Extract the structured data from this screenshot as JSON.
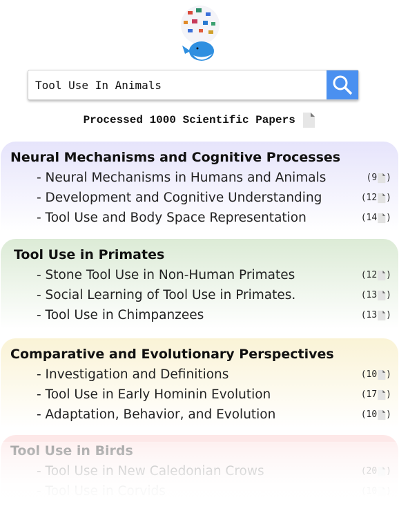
{
  "search": {
    "value": "Tool Use In Animals"
  },
  "processed_label": "Processed 1000 Scientific Papers",
  "sections": [
    {
      "title": "Neural Mechanisms and Cognitive Processes",
      "color": "#e6e4fb",
      "items": [
        {
          "label": "- Neural Mechanisms in Humans and Animals",
          "count": "9"
        },
        {
          "label": "- Development and Cognitive Understanding",
          "count": "12"
        },
        {
          "label": "- Tool Use and Body Space Representation",
          "count": "14"
        }
      ]
    },
    {
      "title": "Tool Use in Primates",
      "color": "#dcebd6",
      "items": [
        {
          "label": "- Stone Tool Use in Non-Human Primates",
          "count": "12"
        },
        {
          "label": "- Social Learning of Tool Use in Primates.",
          "count": "13"
        },
        {
          "label": "- Tool Use in Chimpanzees",
          "count": "13"
        }
      ]
    },
    {
      "title": "Comparative and Evolutionary Perspectives",
      "color": "#faf3d6",
      "items": [
        {
          "label": "- Investigation and Definitions",
          "count": "10"
        },
        {
          "label": "- Tool Use in Early Hominin Evolution",
          "count": "17"
        },
        {
          "label": "- Adaptation, Behavior, and Evolution",
          "count": "10"
        }
      ]
    },
    {
      "title": "Tool Use in Birds",
      "color": "#fcd8d8",
      "items": [
        {
          "label": "- Tool Use in New Caledonian Crows",
          "count": "20"
        },
        {
          "label": "- Tool Use in Corvids",
          "count": "10"
        }
      ]
    }
  ]
}
